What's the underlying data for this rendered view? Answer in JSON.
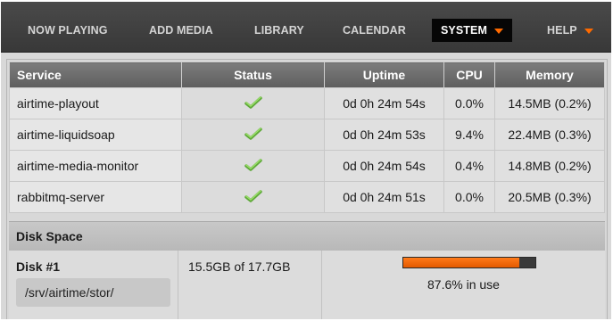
{
  "nav": {
    "items": [
      {
        "label": "NOW PLAYING"
      },
      {
        "label": "ADD MEDIA"
      },
      {
        "label": "LIBRARY"
      },
      {
        "label": "CALENDAR"
      },
      {
        "label": "SYSTEM",
        "active": true,
        "has_dropdown": true
      },
      {
        "label": "HELP",
        "has_dropdown": true
      }
    ],
    "accent_color": "#ff6a00"
  },
  "services_table": {
    "headers": [
      "Service",
      "Status",
      "Uptime",
      "CPU",
      "Memory"
    ],
    "rows": [
      {
        "service": "airtime-playout",
        "status_icon": "check-icon",
        "uptime": "0d 0h 24m 54s",
        "cpu": "0.0%",
        "memory": "14.5MB (0.2%)"
      },
      {
        "service": "airtime-liquidsoap",
        "status_icon": "check-icon",
        "uptime": "0d 0h 24m 53s",
        "cpu": "9.4%",
        "memory": "22.4MB (0.3%)"
      },
      {
        "service": "airtime-media-monitor",
        "status_icon": "check-icon",
        "uptime": "0d 0h 24m 54s",
        "cpu": "0.4%",
        "memory": "14.8MB (0.2%)"
      },
      {
        "service": "rabbitmq-server",
        "status_icon": "check-icon",
        "uptime": "0d 0h 24m 51s",
        "cpu": "0.0%",
        "memory": "20.5MB (0.3%)"
      }
    ]
  },
  "disk": {
    "section_title": "Disk Space",
    "name": "Disk #1",
    "path": "/srv/airtime/stor/",
    "used_text": "15.5GB of 17.7GB",
    "usage_fraction": 0.876,
    "usage_label": "87.6% in use"
  }
}
